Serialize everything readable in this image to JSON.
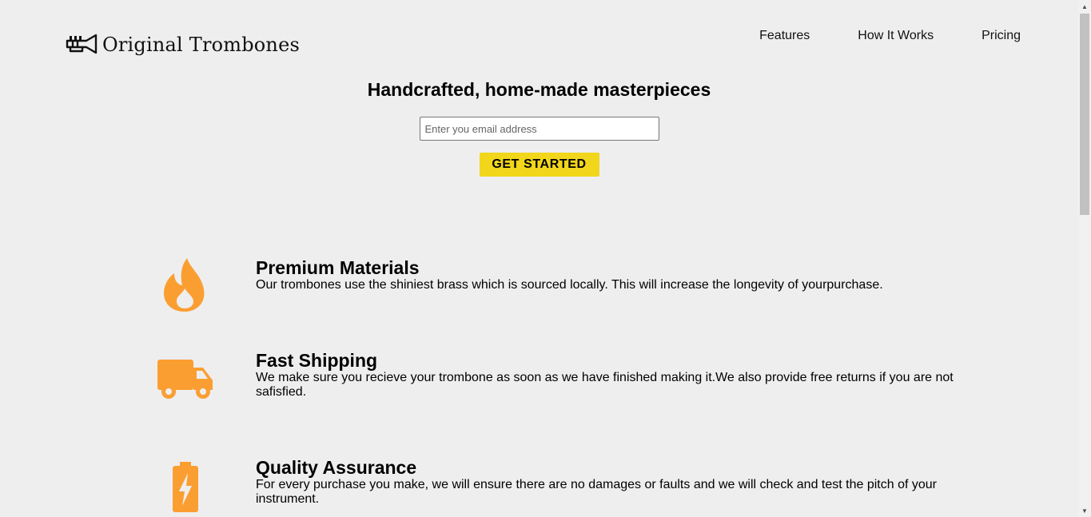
{
  "header": {
    "logo_text": "Original Trombones",
    "logo_icon": "trombone-icon",
    "nav": [
      {
        "label": "Features"
      },
      {
        "label": "How It Works"
      },
      {
        "label": "Pricing"
      }
    ]
  },
  "hero": {
    "title": "Handcrafted, home-made masterpieces",
    "email_placeholder": "Enter you email address",
    "cta_label": "GET STARTED"
  },
  "features": [
    {
      "icon": "fire-icon",
      "title": "Premium Materials",
      "description": "Our trombones use the shiniest brass which is sourced locally. This will increase the longevity of yourpurchase."
    },
    {
      "icon": "truck-icon",
      "title": "Fast Shipping",
      "description": "We make sure you recieve your trombone as soon as we have finished making it.We also provide free returns if you are not safisfied."
    },
    {
      "icon": "battery-bolt-icon",
      "title": "Quality Assurance",
      "description": "For every purchase you make, we will ensure there are no damages or faults and we will check and test the pitch of your instrument."
    }
  ],
  "colors": {
    "background": "#eeeeee",
    "accent_yellow": "#f1d61b",
    "icon_orange": "#fb9e32"
  }
}
